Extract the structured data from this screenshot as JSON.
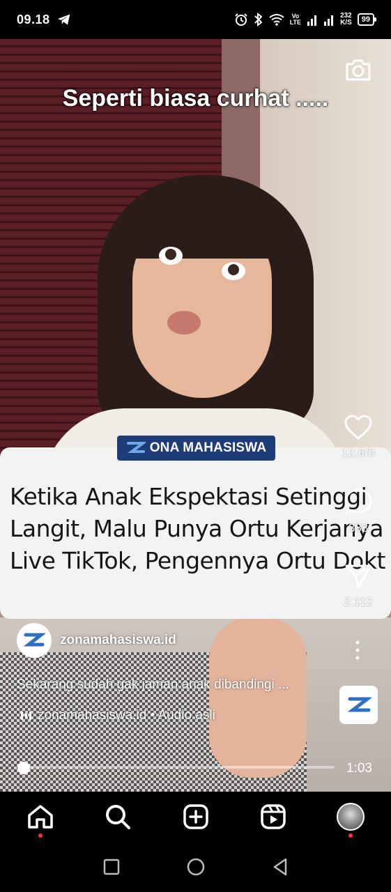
{
  "status_bar": {
    "time": "09.18",
    "volte_top": "Vo",
    "volte_bottom": "LTE",
    "speed_top": "232",
    "speed_bottom": "K/S",
    "battery": "99"
  },
  "video": {
    "caption_overlay": "Seperti biasa curhat .....",
    "card": {
      "brand": "ONA MAHASISWA",
      "title_lines": [
        "Ketika Anak Ekspektasi Setinggi",
        "Langit, Malu Punya Ortu Kerjanya",
        "Live TikTok, Pengennya Ortu Dokter"
      ]
    }
  },
  "actions": {
    "likes": "12,6rb",
    "comments": "338",
    "shares": "2.112"
  },
  "post": {
    "username": "zonamahasiswa.id",
    "description": "Sekarang sudah gak jaman anak dibandingi ...",
    "audio_label": "zonamahasiswa.id • Audio asli",
    "duration": "1:03",
    "progress": 0.02
  },
  "icons": {
    "telegram": "telegram-icon",
    "camera": "camera-icon",
    "heart": "heart-icon",
    "comment": "comment-icon",
    "share": "send-icon",
    "more": "more-vertical-icon",
    "home": "home-icon",
    "search": "search-icon",
    "create": "plus-square-icon",
    "reels": "reels-icon",
    "back": "triangle-back-icon",
    "home_circle": "circle-home-icon",
    "recents": "square-recents-icon"
  },
  "colors": {
    "brand_blue": "#1e3d78",
    "notification_red": "#ff3040"
  }
}
